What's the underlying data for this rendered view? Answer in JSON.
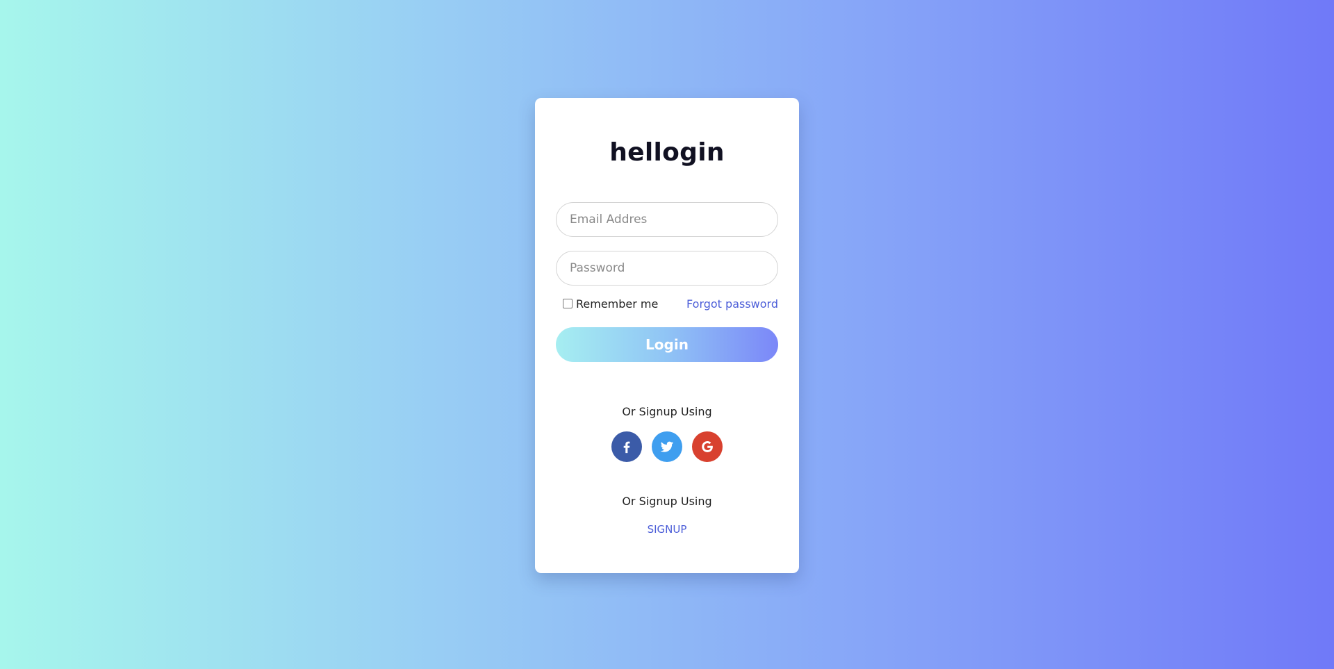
{
  "brand": {
    "title": "hellogin"
  },
  "form": {
    "email_placeholder": "Email Addres",
    "email_value": "",
    "password_placeholder": "Password",
    "password_value": "",
    "remember_label": "Remember me",
    "remember_checked": false,
    "forgot_label": "Forgot password",
    "login_label": "Login"
  },
  "social": {
    "heading": "Or Signup Using",
    "buttons": [
      {
        "icon": "facebook-icon",
        "color": "#3b5ba8"
      },
      {
        "icon": "twitter-icon",
        "color": "#3f9eef"
      },
      {
        "icon": "google-icon",
        "color": "#d8412f"
      }
    ]
  },
  "signup": {
    "heading": "Or Signup Using",
    "link_label": "SIGNUP"
  },
  "colors": {
    "accent": "#4b5dd8",
    "background_start": "#a6f6ec",
    "background_end": "#7079f8"
  }
}
